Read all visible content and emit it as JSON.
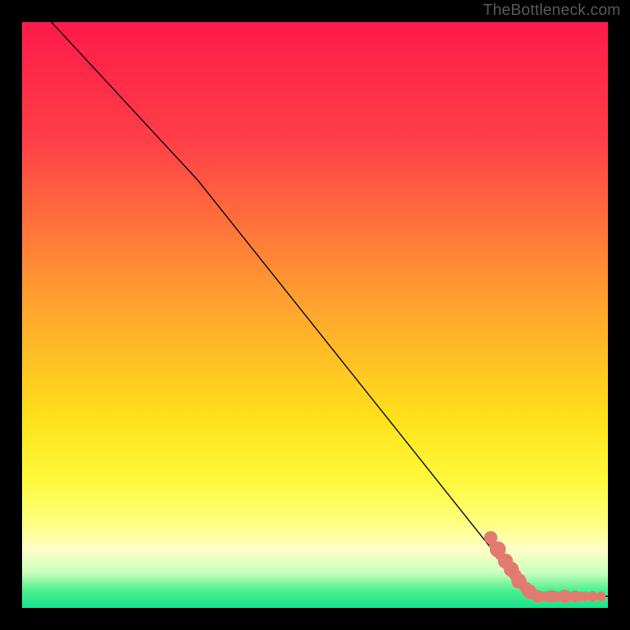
{
  "watermark": "TheBottleneck.com",
  "chart_data": {
    "type": "line",
    "title": "",
    "xlabel": "",
    "ylabel": "",
    "xlim": [
      0,
      100
    ],
    "ylim": [
      0,
      100
    ],
    "gradient_stops": [
      {
        "offset": 0,
        "color": "#ff1a4a"
      },
      {
        "offset": 20,
        "color": "#ff3e48"
      },
      {
        "offset": 48,
        "color": "#ffa22f"
      },
      {
        "offset": 68,
        "color": "#ffe21a"
      },
      {
        "offset": 78,
        "color": "#fff93a"
      },
      {
        "offset": 85,
        "color": "#ffff7b"
      },
      {
        "offset": 90,
        "color": "#ffffc8"
      },
      {
        "offset": 94,
        "color": "#c8ffbe"
      },
      {
        "offset": 97,
        "color": "#4cf08f"
      },
      {
        "offset": 100,
        "color": "#18e28c"
      }
    ],
    "series": [
      {
        "name": "curve",
        "type": "line",
        "color": "#000000",
        "points": [
          {
            "x": 5,
            "y": 100
          },
          {
            "x": 30,
            "y": 73
          },
          {
            "x": 85,
            "y": 4
          },
          {
            "x": 88,
            "y": 2
          },
          {
            "x": 100,
            "y": 2
          }
        ]
      },
      {
        "name": "points",
        "type": "scatter",
        "color": "#e27b6f",
        "points": [
          {
            "x": 80.0,
            "y": 12.0,
            "r": 1.4
          },
          {
            "x": 80.5,
            "y": 10.8,
            "r": 1.0
          },
          {
            "x": 81.2,
            "y": 10.0,
            "r": 1.7
          },
          {
            "x": 81.5,
            "y": 9.0,
            "r": 1.0
          },
          {
            "x": 82.5,
            "y": 8.0,
            "r": 1.6
          },
          {
            "x": 83.0,
            "y": 7.0,
            "r": 1.0
          },
          {
            "x": 83.5,
            "y": 6.6,
            "r": 1.6
          },
          {
            "x": 84.2,
            "y": 5.6,
            "r": 1.3
          },
          {
            "x": 84.8,
            "y": 4.6,
            "r": 1.6
          },
          {
            "x": 85.4,
            "y": 4.0,
            "r": 1.0
          },
          {
            "x": 86.0,
            "y": 3.4,
            "r": 1.3
          },
          {
            "x": 86.6,
            "y": 2.8,
            "r": 1.5
          },
          {
            "x": 87.2,
            "y": 2.4,
            "r": 1.2
          },
          {
            "x": 88.0,
            "y": 2.0,
            "r": 1.3
          },
          {
            "x": 88.8,
            "y": 2.0,
            "r": 1.0
          },
          {
            "x": 89.6,
            "y": 2.0,
            "r": 1.1
          },
          {
            "x": 90.4,
            "y": 2.0,
            "r": 1.3
          },
          {
            "x": 91.0,
            "y": 2.0,
            "r": 1.1
          },
          {
            "x": 91.8,
            "y": 2.0,
            "r": 1.0
          },
          {
            "x": 92.6,
            "y": 2.0,
            "r": 1.4
          },
          {
            "x": 93.4,
            "y": 2.0,
            "r": 1.0
          },
          {
            "x": 94.4,
            "y": 2.0,
            "r": 1.2
          },
          {
            "x": 95.4,
            "y": 2.0,
            "r": 1.0
          },
          {
            "x": 96.2,
            "y": 2.0,
            "r": 1.0
          },
          {
            "x": 97.4,
            "y": 2.0,
            "r": 1.1
          },
          {
            "x": 98.8,
            "y": 2.0,
            "r": 1.0
          }
        ]
      }
    ]
  }
}
